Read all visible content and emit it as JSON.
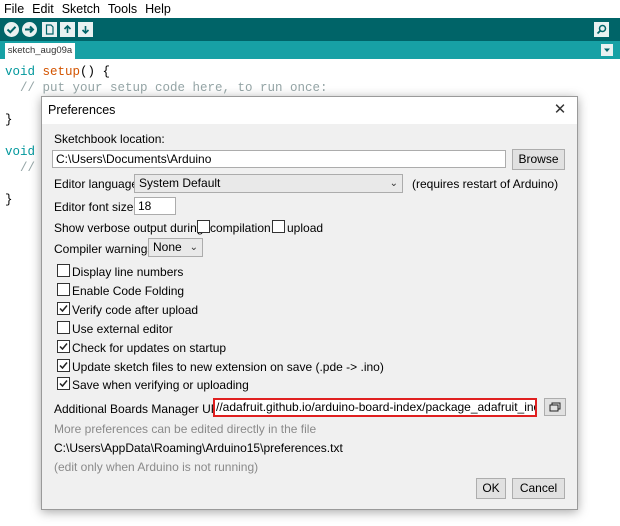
{
  "menu": [
    "File",
    "Edit",
    "Sketch",
    "Tools",
    "Help"
  ],
  "toolbar": {
    "buttons": [
      {
        "name": "verify-icon"
      },
      {
        "name": "upload-icon"
      },
      {
        "name": "new-icon"
      },
      {
        "name": "open-icon"
      },
      {
        "name": "save-icon"
      }
    ],
    "serial_monitor_icon": "magnifier-icon"
  },
  "tab": {
    "label": "sketch_aug09a"
  },
  "code": {
    "line1_kw": "void",
    "line1_fn": "setup",
    "line1_rest": "() {",
    "line2_comment": "// put your setup code here, to run once:",
    "line3": "}",
    "line4_kw": "void",
    "line5_comment": "// p",
    "line6": "}"
  },
  "colors": {
    "toolbar": "#006468",
    "tabbar": "#17a1a5",
    "highlight": "#e02020"
  },
  "dialog": {
    "title": "Preferences",
    "close": "✕",
    "sketchbook_label": "Sketchbook location:",
    "sketchbook_value": "C:\\Users\\Documents\\Arduino",
    "browse": "Browse",
    "language_label": "Editor language:",
    "language_value": "System Default",
    "language_note": "(requires restart of Arduino)",
    "font_label": "Editor font size:",
    "font_value": "18",
    "verbose_label": "Show verbose output during:",
    "verbose_compilation": "compilation",
    "verbose_upload": "upload",
    "warnings_label": "Compiler warnings:",
    "warnings_value": "None",
    "options": [
      {
        "label": "Display line numbers",
        "checked": false
      },
      {
        "label": "Enable Code Folding",
        "checked": false
      },
      {
        "label": "Verify code after upload",
        "checked": true
      },
      {
        "label": "Use external editor",
        "checked": false
      },
      {
        "label": "Check for updates on startup",
        "checked": true
      },
      {
        "label": "Update sketch files to new extension on save (.pde -> .ino)",
        "checked": true
      },
      {
        "label": "Save when verifying or uploading",
        "checked": true
      }
    ],
    "boards_label": "Additional Boards Manager URLs:",
    "boards_value": "//adafruit.github.io/arduino-board-index/package_adafruit_index.json",
    "more_prefs": "More preferences can be edited directly in the file",
    "prefs_path": "C:\\Users\\AppData\\Roaming\\Arduino15\\preferences.txt",
    "edit_note": "(edit only when Arduino is not running)",
    "ok": "OK",
    "cancel": "Cancel"
  }
}
